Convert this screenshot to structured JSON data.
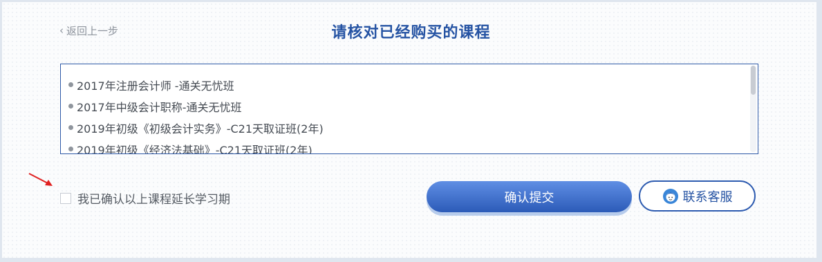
{
  "header": {
    "back_label": "返回上一步",
    "title": "请核对已经购买的课程"
  },
  "courses": [
    "2017年注册会计师 -通关无忧班",
    "2017年中级会计职称-通关无忧班",
    "2019年初级《初级会计实务》-C21天取证班(2年)",
    "2019年初级《经济法基础》-C21天取证班(2年)"
  ],
  "confirm": {
    "checkbox_label": "我已确认以上课程延长学习期",
    "checked": false
  },
  "actions": {
    "submit_label": "确认提交",
    "contact_label": "联系客服",
    "contact_icon": "customer-service-icon"
  },
  "colors": {
    "primary": "#2553a3",
    "button_gradient_top": "#5f8ee4",
    "button_gradient_bottom": "#2c5bb8",
    "annotation_arrow": "#e02020"
  }
}
